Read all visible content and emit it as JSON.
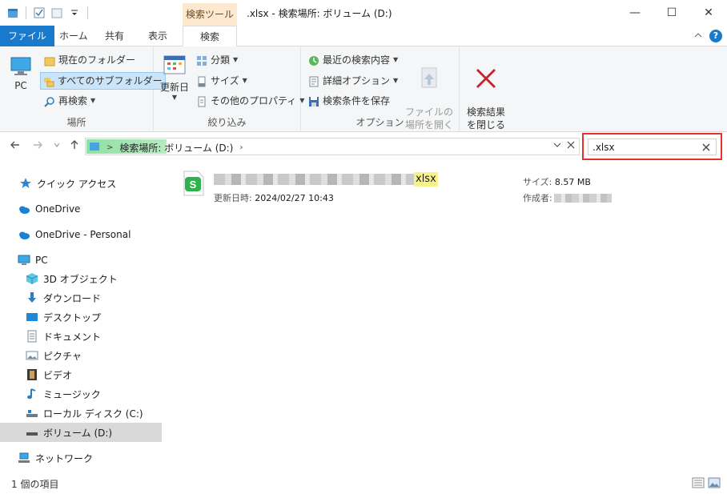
{
  "window": {
    "title": ".xlsx - 検索場所: ボリューム (D:)",
    "context_tab_label": "検索ツール",
    "controls": {
      "minimize": "—",
      "maximize": "☐",
      "close": "✕"
    }
  },
  "ribbon_tabs": [
    {
      "label": "ファイル"
    },
    {
      "label": "ホーム"
    },
    {
      "label": "共有"
    },
    {
      "label": "表示"
    },
    {
      "label": "検索"
    }
  ],
  "ribbon": {
    "location": {
      "label": "場所",
      "pc": "PC",
      "current_folder": "現在のフォルダー",
      "all_subfolders": "すべてのサブフォルダー",
      "search_again": "再検索"
    },
    "refine": {
      "label": "絞り込み",
      "date_modified": "更新日",
      "kind": "分類",
      "size": "サイズ",
      "other_properties": "その他のプロパティ"
    },
    "options": {
      "label": "オプション",
      "recent_searches": "最近の検索内容",
      "advanced_options": "詳細オプション",
      "save_search": "検索条件を保存",
      "open_file_location": "ファイルの\n場所を開く"
    },
    "close_search": "検索結果\nを閉じる"
  },
  "address_bar": {
    "chevron": ">",
    "path": "検索場所: ボリューム (D:)",
    "search_value": ".xlsx"
  },
  "nav_pane": {
    "quick_access": "クイック アクセス",
    "onedrive": "OneDrive",
    "onedrive_personal": "OneDrive - Personal",
    "pc": "PC",
    "items": [
      {
        "label": "3D オブジェクト"
      },
      {
        "label": "ダウンロード"
      },
      {
        "label": "デスクトップ"
      },
      {
        "label": "ドキュメント"
      },
      {
        "label": "ピクチャ"
      },
      {
        "label": "ビデオ"
      },
      {
        "label": "ミュージック"
      },
      {
        "label": "ローカル ディスク (C:)"
      },
      {
        "label": "ボリューム (D:)"
      }
    ],
    "network": "ネットワーク"
  },
  "results": [
    {
      "name_highlight": "xlsx",
      "modified_label": "更新日時:",
      "modified_value": "2024/02/27 10:43",
      "size_label": "サイズ:",
      "size_value": "8.57 MB",
      "author_label": "作成者:"
    }
  ],
  "status": {
    "item_count": "1 個の項目"
  },
  "colors": {
    "accent": "#1979ca",
    "context_tab": "#fde9d0",
    "search_outline": "#e5322d",
    "match_highlight": "#f7f38a"
  }
}
